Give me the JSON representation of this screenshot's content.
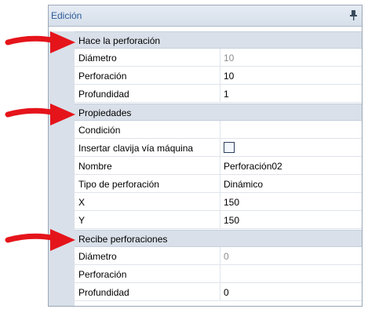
{
  "panel": {
    "title": "Edición",
    "pin_icon": "pin-icon"
  },
  "categories": [
    {
      "label": "Hace la perforación",
      "rows": [
        {
          "name": "Diámetro",
          "value": "10",
          "disabled": true
        },
        {
          "name": "Perforación",
          "value": "10",
          "disabled": false
        },
        {
          "name": "Profundidad",
          "value": "1",
          "disabled": false
        }
      ]
    },
    {
      "label": "Propiedades",
      "rows": [
        {
          "name": "Condición",
          "value": "",
          "disabled": false
        },
        {
          "name": "Insertar clavija vía máquina",
          "value": "",
          "checkbox": true,
          "checked": false
        },
        {
          "name": "Nombre",
          "value": "Perforación02",
          "disabled": false
        },
        {
          "name": "Tipo de perforación",
          "value": "Dinámico",
          "disabled": false
        },
        {
          "name": "X",
          "value": "150",
          "disabled": false
        },
        {
          "name": "Y",
          "value": "150",
          "disabled": false
        }
      ]
    },
    {
      "label": "Recibe perforaciones",
      "rows": [
        {
          "name": "Diámetro",
          "value": "0",
          "disabled": true
        },
        {
          "name": "Perforación",
          "value": "",
          "disabled": false
        },
        {
          "name": "Profundidad",
          "value": "0",
          "disabled": false
        }
      ]
    }
  ],
  "colors": {
    "arrow": "#e5141b",
    "category_bg": "#d9e0e9",
    "title_text": "#2b5a99"
  }
}
